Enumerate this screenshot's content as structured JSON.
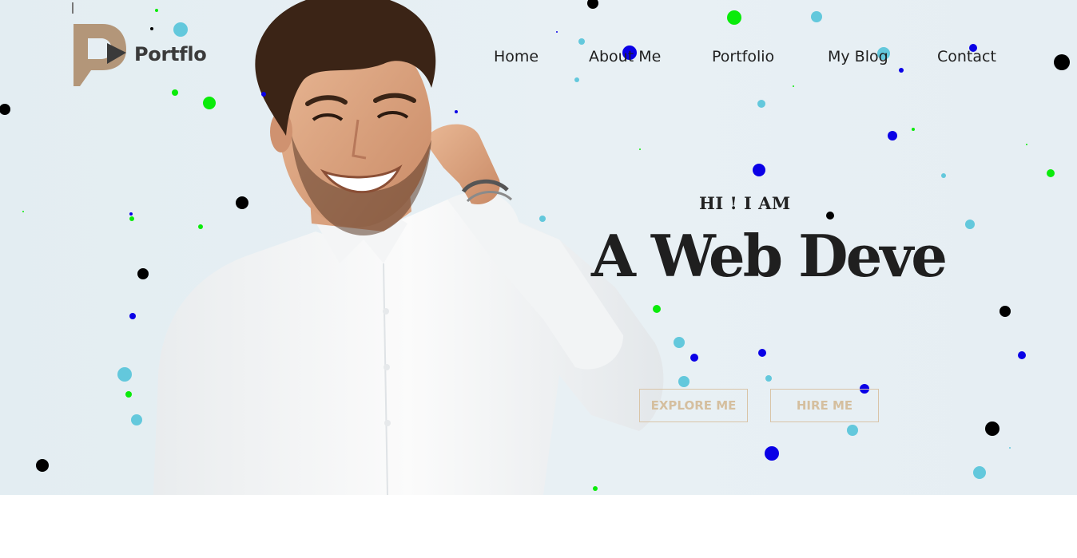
{
  "header": {
    "logo_text": "Portflo",
    "nav": [
      {
        "label": "Home"
      },
      {
        "label": "About Me"
      },
      {
        "label": "Portfolio"
      },
      {
        "label": "My Blog"
      },
      {
        "label": "Contact"
      }
    ]
  },
  "hero": {
    "greeting": "HI ! I AM",
    "headline": "A Web Deve",
    "buttons": {
      "explore": "EXPLORE ME",
      "hire": "HIRE ME"
    }
  },
  "colors": {
    "hero_bg": "#e6eef3",
    "text_dark": "#1f1f1f",
    "button_accent": "#d5bf9f",
    "particle_cyan": "#63c8dc",
    "particle_blue": "#0a00e6",
    "particle_green": "#0aeb0a",
    "particle_black": "#000000",
    "logo_accent": "#b89c83"
  }
}
